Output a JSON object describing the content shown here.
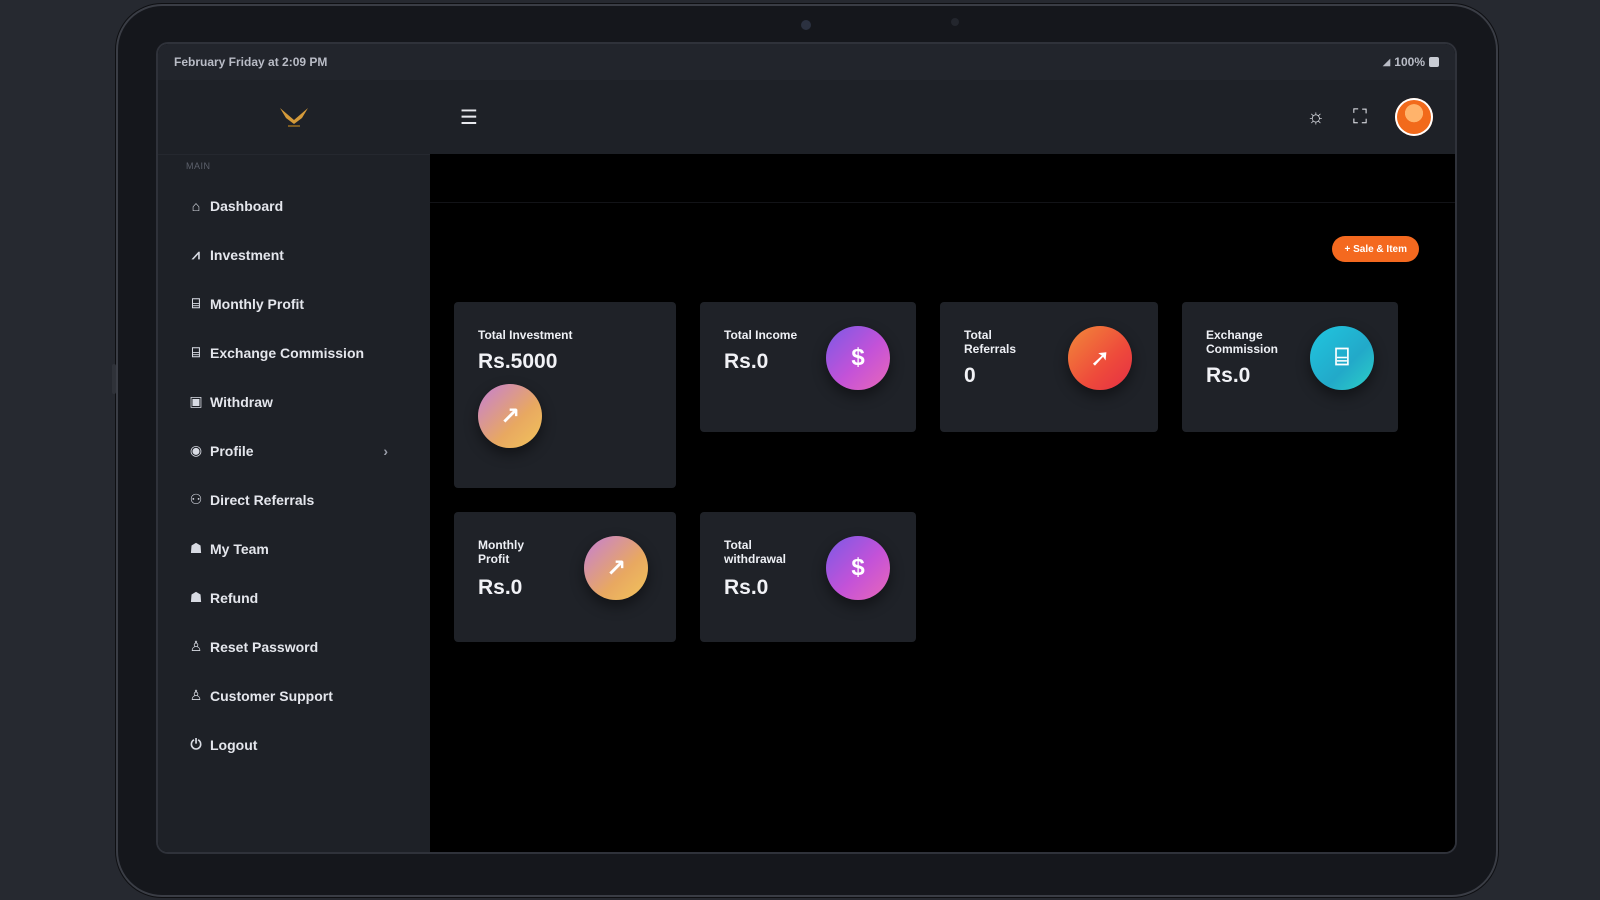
{
  "status_bar": {
    "left": "February Friday at 2:09 PM",
    "right": "100%"
  },
  "sidebar": {
    "section_title": "MAIN",
    "items": [
      {
        "label": "Dashboard",
        "icon": "home-icon"
      },
      {
        "label": "Investment",
        "icon": "chart-icon"
      },
      {
        "label": "Monthly Profit",
        "icon": "bank-icon"
      },
      {
        "label": "Exchange Commission",
        "icon": "bank-icon"
      },
      {
        "label": "Withdraw",
        "icon": "wallet-icon"
      },
      {
        "label": "Profile",
        "icon": "user-icon"
      },
      {
        "label": "Direct Referrals",
        "icon": "users-icon"
      },
      {
        "label": "My Team",
        "icon": "team-icon"
      },
      {
        "label": "Refund",
        "icon": "refund-icon"
      },
      {
        "label": "Reset Password",
        "icon": "lock-user-icon"
      },
      {
        "label": "Customer Support",
        "icon": "support-icon"
      },
      {
        "label": "Logout",
        "icon": "logout-icon"
      }
    ]
  },
  "content": {
    "add_button": "+ Sale & Item"
  },
  "cards": [
    {
      "label": "Total Investment",
      "value": "Rs.5000"
    },
    {
      "label": "Total Income",
      "value": "Rs.0"
    },
    {
      "label": "Total Referrals",
      "value": "0"
    },
    {
      "label": "Exchange Commission",
      "value": "Rs.0"
    },
    {
      "label": "Monthly Profit",
      "value": "Rs.0"
    },
    {
      "label": "Total withdrawal",
      "value": "Rs.0"
    }
  ],
  "colors": {
    "accent": "#f4691f",
    "sidebar_bg": "#1e2127",
    "card_bg": "#1f2228"
  }
}
